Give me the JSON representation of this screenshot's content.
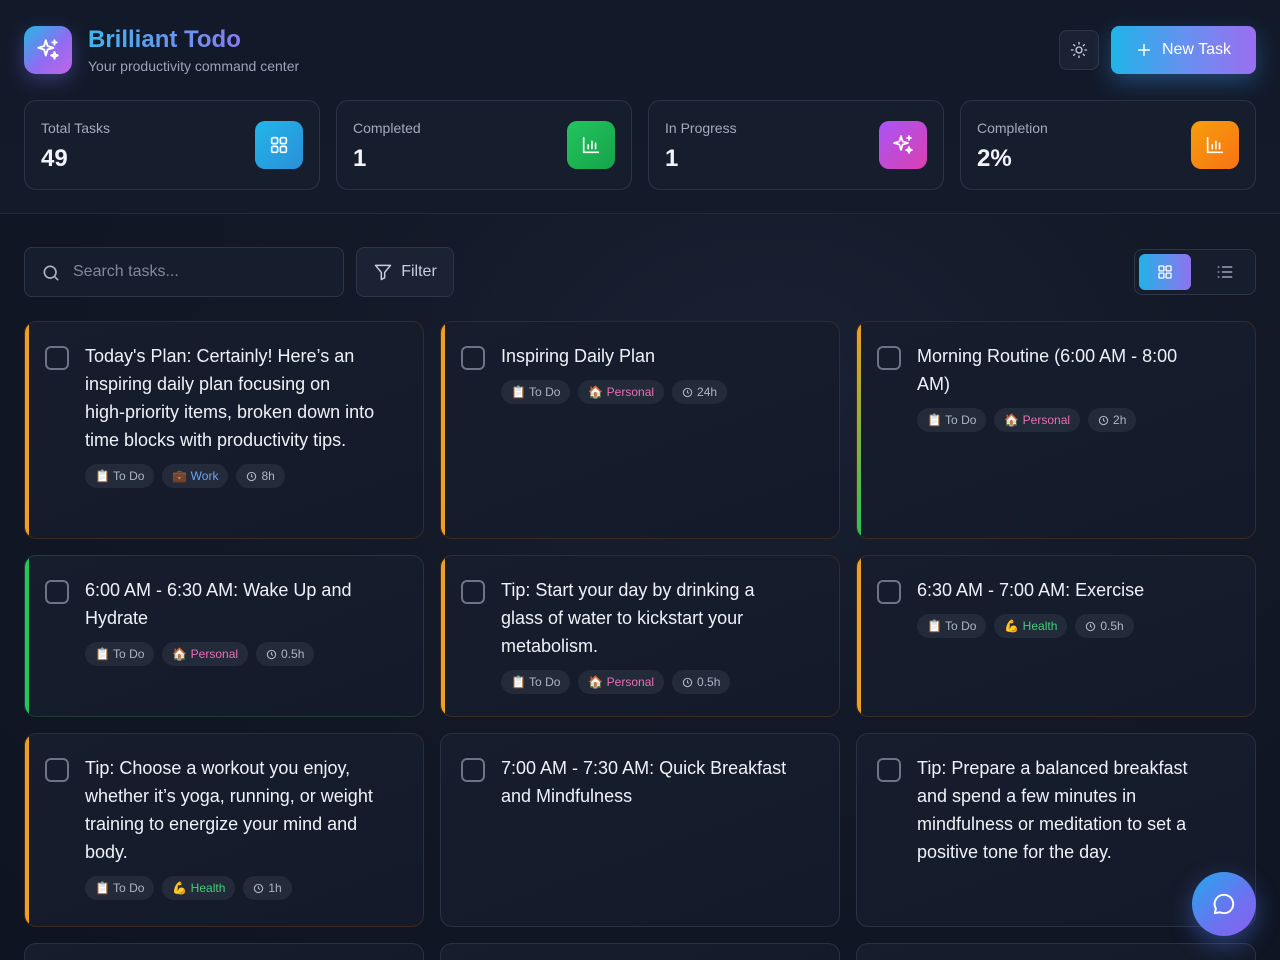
{
  "header": {
    "title": "Brilliant Todo",
    "subtitle": "Your productivity command center",
    "new_task_label": "New Task"
  },
  "stats": [
    {
      "label": "Total Tasks",
      "value": "49",
      "icon": "grid-icon",
      "color": "#22a6e0"
    },
    {
      "label": "Completed",
      "value": "1",
      "icon": "chart-icon",
      "color": "#22c55e"
    },
    {
      "label": "In Progress",
      "value": "1",
      "icon": "sparkles-icon",
      "color": "#c04fd8"
    },
    {
      "label": "Completion",
      "value": "2%",
      "icon": "chart-icon",
      "color": "#f59e0b"
    }
  ],
  "toolbar": {
    "search_placeholder": "Search tasks...",
    "filter_label": "Filter"
  },
  "colors": {
    "accent_orange": "#f0a020",
    "accent_green": "#22c55e",
    "brand_blue": "#22b8e6",
    "brand_purple": "#8f6cf0"
  },
  "tasks": [
    {
      "title": "Today's Plan: Certainly! Here’s an inspiring daily plan focusing on high-priority items, broken down into time blocks with productivity tips.",
      "status": "📋 To Do",
      "category": "💼 Work",
      "category_type": "work",
      "time": "8h",
      "accent": "orange"
    },
    {
      "title": "Inspiring Daily Plan",
      "status": "📋 To Do",
      "category": "🏠 Personal",
      "category_type": "personal",
      "time": "24h",
      "accent": "orange"
    },
    {
      "title": "Morning Routine (6:00 AM - 8:00 AM)",
      "status": "📋 To Do",
      "category": "🏠 Personal",
      "category_type": "personal",
      "time": "2h",
      "accent": "orange-green"
    },
    {
      "title": "6:00 AM - 6:30 AM: Wake Up and Hydrate",
      "status": "📋 To Do",
      "category": "🏠 Personal",
      "category_type": "personal",
      "time": "0.5h",
      "accent": "green"
    },
    {
      "title": "Tip: Start your day by drinking a glass of water to kickstart your metabolism.",
      "status": "📋 To Do",
      "category": "🏠 Personal",
      "category_type": "personal",
      "time": "0.5h",
      "accent": "orange"
    },
    {
      "title": "6:30 AM - 7:00 AM: Exercise",
      "status": "📋 To Do",
      "category": "💪 Health",
      "category_type": "health",
      "time": "0.5h",
      "accent": "orange"
    },
    {
      "title": "Tip: Choose a workout you enjoy, whether it’s yoga, running, or weight training to energize your mind and body.",
      "status": "📋 To Do",
      "category": "💪 Health",
      "category_type": "health",
      "time": "1h",
      "accent": "orange"
    },
    {
      "title": "7:00 AM - 7:30 AM: Quick Breakfast and Mindfulness",
      "status": "",
      "category": "",
      "category_type": "",
      "time": "",
      "accent": "none"
    },
    {
      "title": "Tip: Prepare a balanced breakfast and spend a few minutes in mindfulness or meditation to set a positive tone for the day.",
      "status": "",
      "category": "",
      "category_type": "",
      "time": "",
      "accent": "none"
    }
  ]
}
